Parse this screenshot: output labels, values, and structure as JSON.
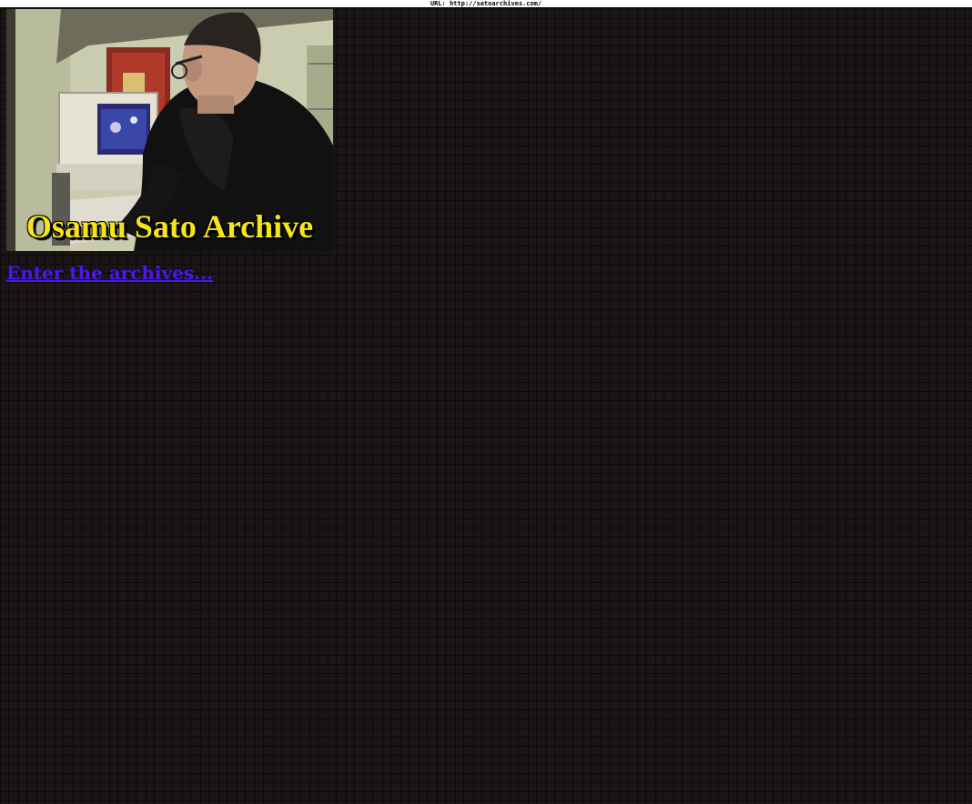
{
  "browser": {
    "url_label": "URL: http://satoarchives.com/"
  },
  "banner": {
    "title": "Osamu Sato Archive",
    "image_description_icon": "photo-person-at-computer"
  },
  "main": {
    "enter_link_label": "Enter the archives..."
  },
  "colors": {
    "background": "#1a1516",
    "link": "#4a18e8",
    "title_yellow": "#f5e41a"
  }
}
